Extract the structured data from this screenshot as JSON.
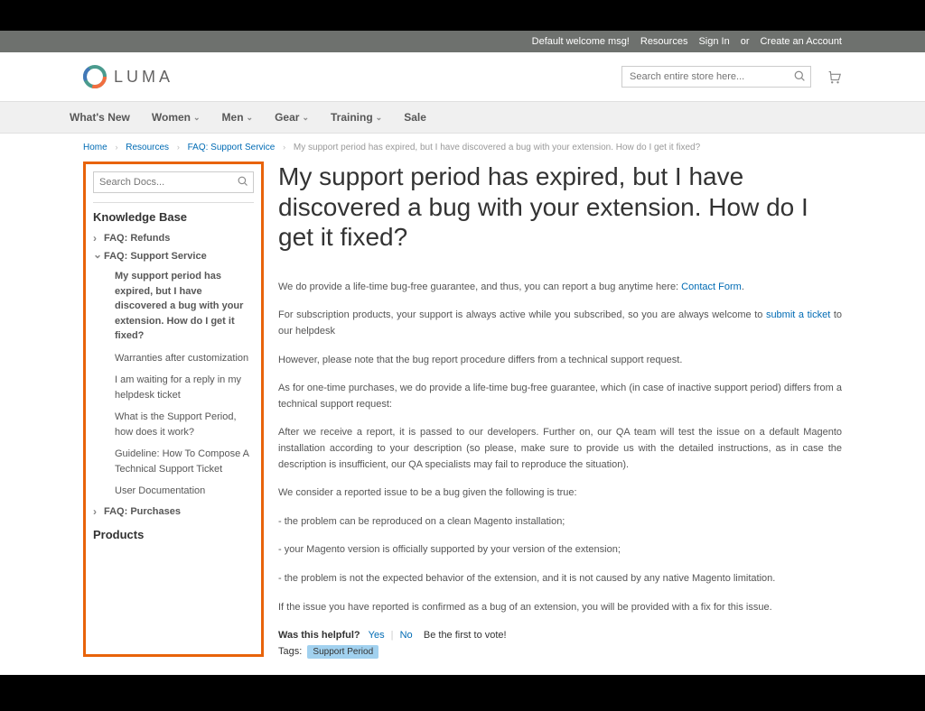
{
  "header": {
    "welcome": "Default welcome msg!",
    "resources": "Resources",
    "sign_in": "Sign In",
    "or": "or",
    "create_account": "Create an Account",
    "logo_text": "LUMA",
    "search_placeholder": "Search entire store here..."
  },
  "nav": {
    "whats_new": "What's New",
    "women": "Women",
    "men": "Men",
    "gear": "Gear",
    "training": "Training",
    "sale": "Sale"
  },
  "breadcrumbs": {
    "home": "Home",
    "resources": "Resources",
    "faq": "FAQ: Support Service",
    "current": "My support period has expired, but I have discovered a bug with your extension. How do I get it fixed?"
  },
  "sidebar": {
    "search_placeholder": "Search Docs...",
    "kb_heading": "Knowledge Base",
    "products_heading": "Products",
    "tree": {
      "refunds": "FAQ: Refunds",
      "support_service": "FAQ: Support Service",
      "items": [
        "My support period has expired, but I have discovered a bug with your extension. How do I get it fixed?",
        "Warranties after customization",
        "I am waiting for a reply in my helpdesk ticket",
        "What is the Support Period, how does it work?",
        "Guideline: How To Compose A Technical Support Ticket",
        "User Documentation"
      ],
      "purchases": "FAQ: Purchases"
    }
  },
  "article": {
    "title": "My support period has expired, but I have discovered a bug with your extension. How do I get it fixed?",
    "p1a": "We do provide a life-time bug-free guarantee, and thus, you can report a bug anytime here: ",
    "p1link": "Contact Form",
    "p2a": "For subscription products, your support is always active while you subscribed, so you are always welcome to ",
    "p2link": "submit a ticket",
    "p2b": " to our helpdesk",
    "p3": "However, please note that the bug report procedure differs from a technical support request.",
    "p4": "As for one-time purchases, we do provide a life-time bug-free guarantee, which (in case of inactive support period) differs from a technical support request:",
    "p5": "After we receive a report, it is passed to our developers. Further on, our QA team will test the issue on a default Magento installation according to your description (so please, make sure to provide us with the detailed instructions, as in case the description is insufficient, our QA specialists may fail to reproduce the situation).",
    "p6": "We consider a reported issue to be a bug given the following is true:",
    "p7": "- the problem can be reproduced on a clean Magento installation;",
    "p8": "- your Magento version is officially supported by your version of the extension;",
    "p9": "- the problem is not the expected behavior of the extension, and it is not caused by any native Magento limitation.",
    "p10": "If the issue you have reported is confirmed as a bug of an extension, you will be provided with a fix for this issue."
  },
  "helpful": {
    "label": "Was this helpful?",
    "yes": "Yes",
    "no": "No",
    "first": "Be the first to vote!"
  },
  "tags": {
    "label": "Tags:",
    "chip": "Support Period"
  }
}
